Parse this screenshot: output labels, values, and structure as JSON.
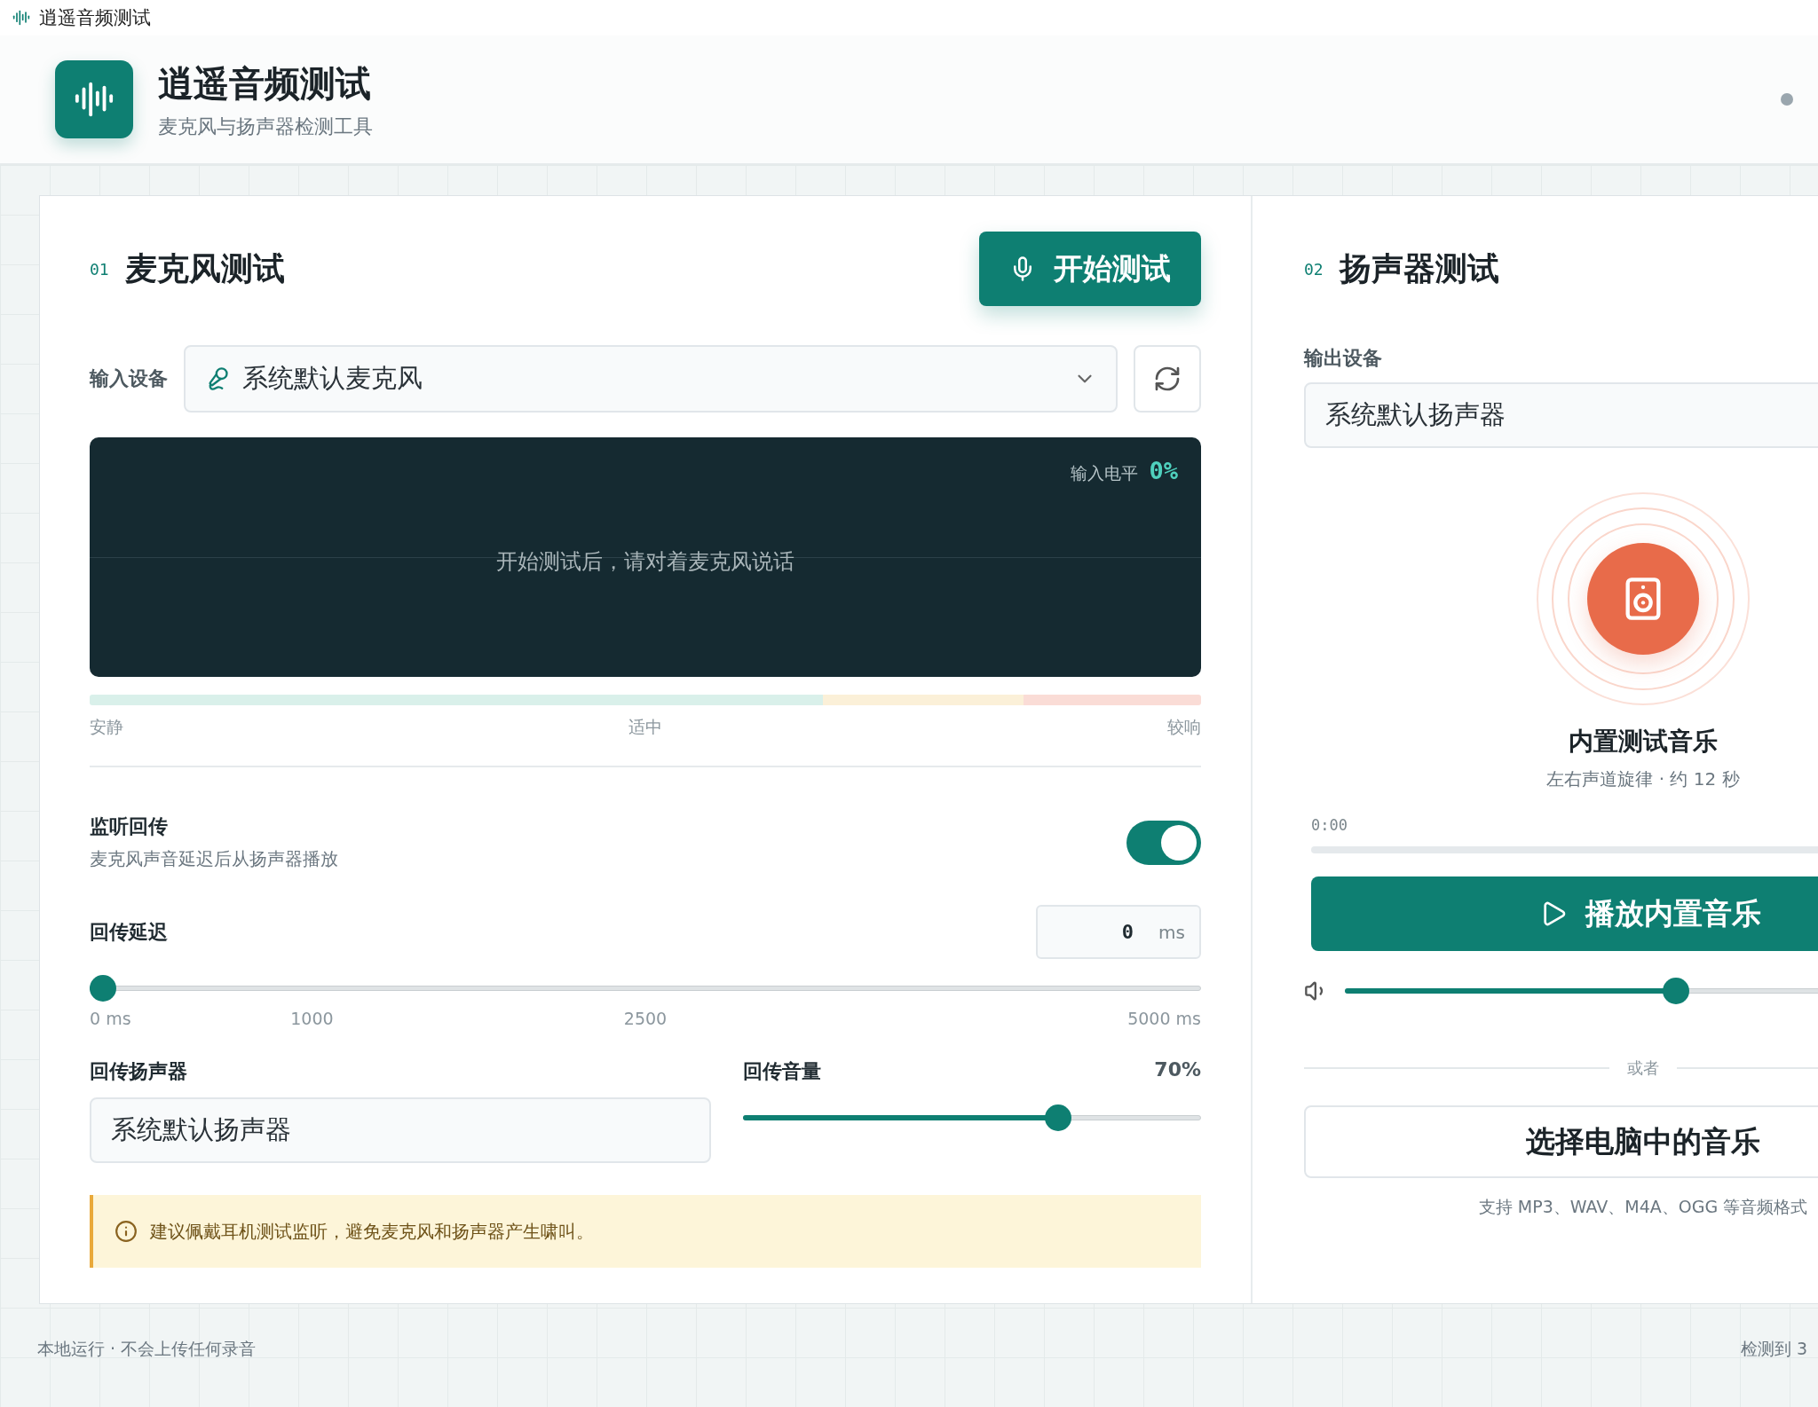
{
  "window": {
    "title": "逍遥音频测试"
  },
  "header": {
    "title": "逍遥音频测试",
    "subtitle": "麦克风与扬声器检测工具"
  },
  "mic_panel": {
    "index": "01",
    "title": "麦克风测试",
    "start_button": "开始测试",
    "input_device": {
      "label": "输入设备",
      "value": "系统默认麦克风"
    },
    "visualizer": {
      "level_label": "输入电平",
      "level_value": "0%",
      "hint": "开始测试后，请对着麦克风说话"
    },
    "scale_labels": [
      "安静",
      "适中",
      "较响"
    ],
    "monitor": {
      "title": "监听回传",
      "description": "麦克风声音延迟后从扬声器播放",
      "on": true
    },
    "delay": {
      "label": "回传延迟",
      "value": "0",
      "unit": "ms",
      "level": 0,
      "ticks": [
        "0 ms",
        "1000",
        "2500",
        "5000 ms"
      ]
    },
    "echo_speaker": {
      "label": "回传扬声器",
      "value": "系统默认扬声器"
    },
    "echo_volume": {
      "label": "回传音量",
      "reading": "70%",
      "level": 0.7
    },
    "warning": "建议佩戴耳机测试监听，避免麦克风和扬声器产生啸叫。"
  },
  "speaker_panel": {
    "index": "02",
    "title": "扬声器测试",
    "output_device": {
      "label": "输出设备",
      "value": "系统默认扬声器"
    },
    "track": {
      "title": "内置测试音乐",
      "subtitle": "左右声道旋律 · 约 12 秒",
      "time": "0:00",
      "level": 0
    },
    "play_button": "播放内置音乐",
    "volume": {
      "level": 0.52
    },
    "divider": "或者",
    "choose_button": "选择电脑中的音乐",
    "formats_note": "支持 MP3、WAV、M4A、OGG 等音频格式"
  },
  "footer": {
    "left": "本地运行 · 不会上传任何录音",
    "right": "检测到 3"
  }
}
